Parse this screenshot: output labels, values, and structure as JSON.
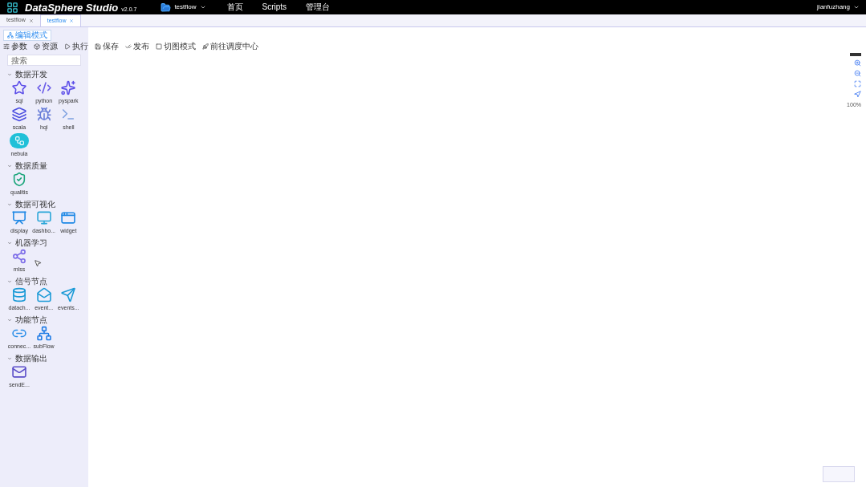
{
  "header": {
    "brand": "DataSphere Studio",
    "version": "v2.0.7",
    "workspace": "testflow",
    "nav": [
      "首页",
      "Scripts",
      "管理台"
    ],
    "user": "jianfuzhang"
  },
  "tabs": [
    {
      "label": "testflow",
      "selected": false
    },
    {
      "label": "testflow",
      "selected": true
    }
  ],
  "mode_button": "编辑模式",
  "toolbar": [
    {
      "kind": "params",
      "label": "参数"
    },
    {
      "kind": "resource",
      "label": "资源"
    },
    {
      "kind": "run",
      "label": "执行"
    },
    {
      "kind": "save",
      "label": "保存"
    },
    {
      "kind": "publish",
      "label": "发布"
    },
    {
      "kind": "view",
      "label": "切图模式"
    },
    {
      "kind": "schedule",
      "label": "前往调度中心"
    }
  ],
  "search": {
    "placeholder": "搜索"
  },
  "categories": [
    {
      "title": "数据开发",
      "expanded": true,
      "nodes": [
        {
          "kind": "star",
          "label": "sql"
        },
        {
          "kind": "python",
          "label": "python"
        },
        {
          "kind": "sparkle",
          "label": "pyspark"
        },
        {
          "kind": "layers",
          "label": "scala"
        },
        {
          "kind": "bee",
          "label": "hql"
        },
        {
          "kind": "terminal",
          "label": "shell"
        },
        {
          "kind": "nebula",
          "label": "nebula"
        }
      ]
    },
    {
      "title": "数据质量",
      "expanded": true,
      "nodes": [
        {
          "kind": "shield",
          "label": "qualitis"
        }
      ]
    },
    {
      "title": "数据可视化",
      "expanded": true,
      "nodes": [
        {
          "kind": "presentation",
          "label": "display"
        },
        {
          "kind": "monitor",
          "label": "dashbo..."
        },
        {
          "kind": "window",
          "label": "widget"
        }
      ]
    },
    {
      "title": "机器学习",
      "expanded": true,
      "nodes": [
        {
          "kind": "share",
          "label": "mlss"
        }
      ]
    },
    {
      "title": "信号节点",
      "expanded": true,
      "nodes": [
        {
          "kind": "database",
          "label": "datach..."
        },
        {
          "kind": "mail",
          "label": "event..."
        },
        {
          "kind": "send",
          "label": "events..."
        }
      ]
    },
    {
      "title": "功能节点",
      "expanded": true,
      "nodes": [
        {
          "kind": "link",
          "label": "connec..."
        },
        {
          "kind": "network",
          "label": "subFlow"
        }
      ]
    },
    {
      "title": "数据输出",
      "expanded": true,
      "nodes": [
        {
          "kind": "mailbox",
          "label": "sendE..."
        }
      ]
    }
  ],
  "zoom": {
    "reading": "100%"
  }
}
